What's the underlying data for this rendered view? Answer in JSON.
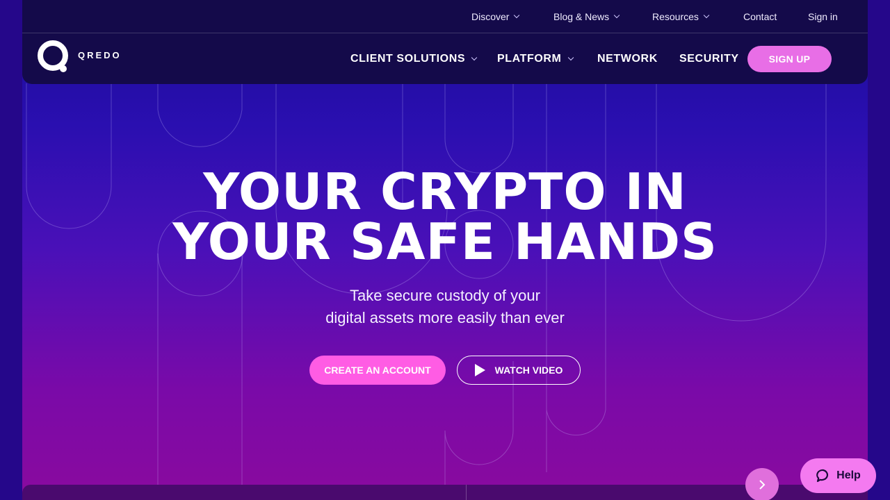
{
  "top_nav": {
    "discover": "Discover",
    "blog_news": "Blog & News",
    "resources": "Resources",
    "contact": "Contact",
    "sign_in": "Sign in"
  },
  "logo": {
    "text": "QREDO"
  },
  "main_nav": {
    "client_solutions": "CLIENT SOLUTIONS",
    "platform": "PLATFORM",
    "network": "NETWORK",
    "security": "SECURITY",
    "sign_up": "SIGN UP"
  },
  "hero": {
    "headline_line1": "YOUR CRYPTO IN",
    "headline_line2": "YOUR SAFE HANDS",
    "subline_line1": "Take secure custody of your",
    "subline_line2": "digital assets more easily than ever",
    "create_account": "CREATE AN ACCOUNT",
    "watch_video": "WATCH VIDEO"
  },
  "help": {
    "label": "Help"
  },
  "icons": {
    "caret": "chevron-down-icon",
    "play": "play-icon",
    "next": "chevron-right-icon",
    "chat": "chat-bubble-icon"
  },
  "colors": {
    "header_bg": "#140a4a",
    "accent_pink": "#ff5ce4",
    "signup_pink": "#e86ee6",
    "help_pink": "#f47af0"
  }
}
